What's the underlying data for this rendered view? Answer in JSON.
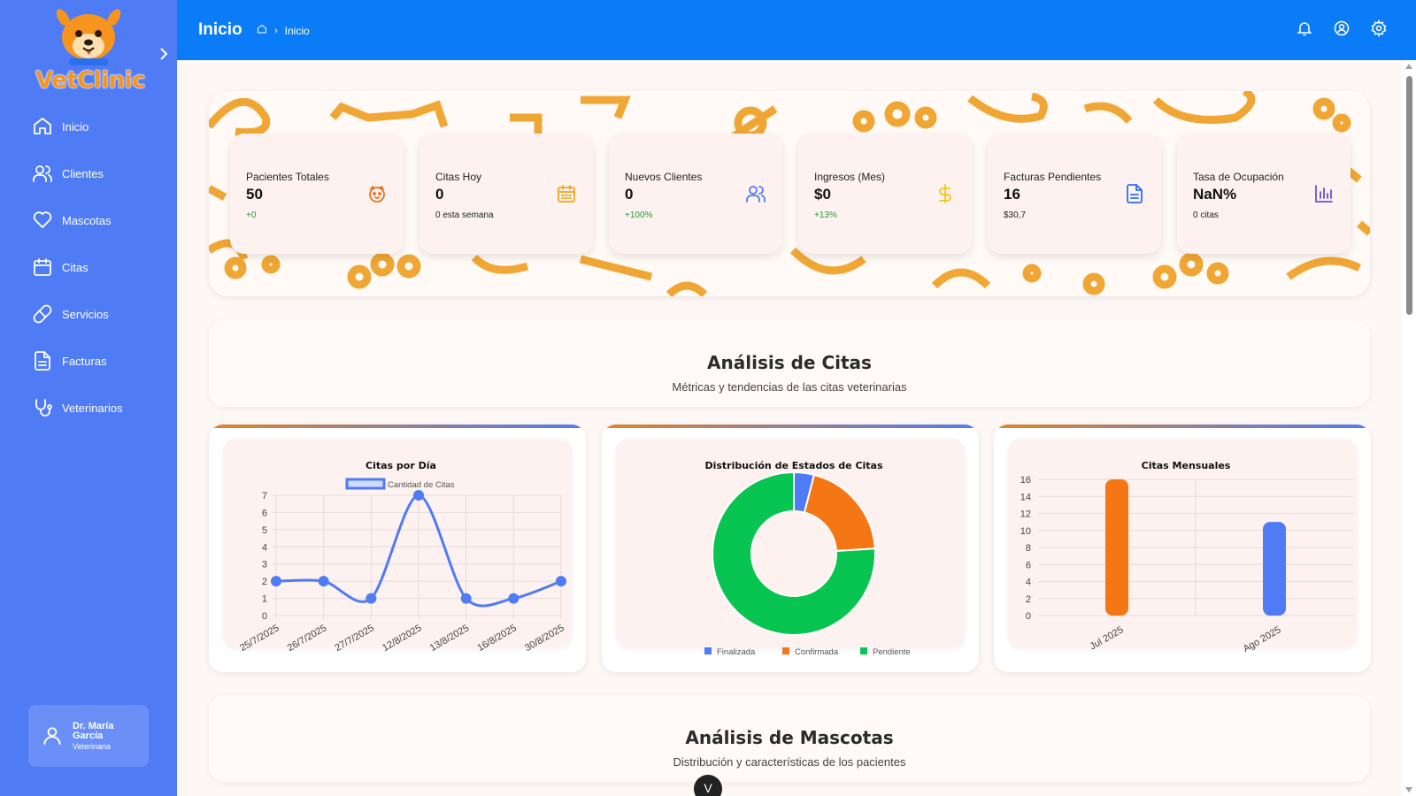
{
  "brand": {
    "name": "VetClinic",
    "logo_icon": "dog-logo-icon",
    "accent": "#f7941d"
  },
  "sidebar": {
    "bg_color": "#4f7bf5",
    "items": [
      {
        "label": "Inicio",
        "icon": "home-icon"
      },
      {
        "label": "Clientes",
        "icon": "users-icon"
      },
      {
        "label": "Mascotas",
        "icon": "heart-icon"
      },
      {
        "label": "Citas",
        "icon": "calendar-icon"
      },
      {
        "label": "Servicios",
        "icon": "pill-icon"
      },
      {
        "label": "Facturas",
        "icon": "document-icon"
      },
      {
        "label": "Veterinarios",
        "icon": "stethoscope-icon"
      }
    ],
    "user": {
      "name": "Dr. María García",
      "role": "Veterinaria",
      "icon": "user-icon"
    }
  },
  "header": {
    "title": "Inicio",
    "breadcrumb": {
      "home_icon": "home-icon",
      "current": "Inicio"
    },
    "bg_color": "#0a7cf7",
    "icons": [
      "bell-icon",
      "user-circle-icon",
      "gear-icon"
    ]
  },
  "stats": [
    {
      "label": "Pacientes Totales",
      "value": "50",
      "sub": "+0",
      "sub_color": "#1e9d3a",
      "icon": "paw-icon",
      "icon_color": "#e8701f"
    },
    {
      "label": "Citas Hoy",
      "value": "0",
      "sub": "0 esta semana",
      "sub_color": "#222222",
      "icon": "calendar-icon",
      "icon_color": "#f2a516"
    },
    {
      "label": "Nuevos Clientes",
      "value": "0",
      "sub": "+100%",
      "sub_color": "#1e9d3a",
      "icon": "users-icon",
      "icon_color": "#4f7bf5"
    },
    {
      "label": "Ingresos (Mes)",
      "value": "$0",
      "sub": "+13%",
      "sub_color": "#1e9d3a",
      "icon": "dollar-icon",
      "icon_color": "#f2c516"
    },
    {
      "label": "Facturas Pendientes",
      "value": "16",
      "sub": "$30,7",
      "sub_color": "#222222",
      "icon": "document-icon",
      "icon_color": "#2a6ff0"
    },
    {
      "label": "Tasa de Ocupación",
      "value": "NaN%",
      "sub": "0 citas",
      "sub_color": "#222222",
      "icon": "bar-chart-icon",
      "icon_color": "#6a4fd8"
    }
  ],
  "sections": {
    "citas": {
      "title": "Análisis de Citas",
      "subtitle": "Métricas y tendencias de las citas veterinarias"
    },
    "mascotas": {
      "title": "Análisis de Mascotas",
      "subtitle": "Distribución y características de los pacientes"
    }
  },
  "chart_data": [
    {
      "type": "line",
      "title": "Citas por Día",
      "categories": [
        "25/7/2025",
        "26/7/2025",
        "27/7/2025",
        "12/8/2025",
        "13/8/2025",
        "16/8/2025",
        "30/8/2025"
      ],
      "series": [
        {
          "name": "Cantidad de Citas",
          "values": [
            2,
            2,
            1,
            7,
            1,
            1,
            2
          ],
          "color": "#4f7bf5"
        }
      ],
      "ylim": [
        0,
        7
      ],
      "yticks": [
        0,
        1,
        2,
        3,
        4,
        5,
        6,
        7
      ],
      "grid": true,
      "legend": "top"
    },
    {
      "type": "pie",
      "title": "Distribución de Estados de Citas",
      "labels": [
        "Finalizada",
        "Confirmada",
        "Pendiente"
      ],
      "values": [
        2,
        10,
        38
      ],
      "colors": [
        "#4f7bf5",
        "#f57614",
        "#08c451"
      ],
      "donut": true,
      "legend": "bottom"
    },
    {
      "type": "bar",
      "title": "Citas Mensuales",
      "categories": [
        "Jul 2025",
        "Ago 2025"
      ],
      "values": [
        16,
        11
      ],
      "colors": [
        "#f57614",
        "#4f7bf5"
      ],
      "ylim": [
        0,
        16
      ],
      "yticks": [
        0,
        2,
        4,
        6,
        8,
        10,
        12,
        14,
        16
      ],
      "grid": true
    }
  ],
  "floating_button": {
    "label": "V"
  }
}
